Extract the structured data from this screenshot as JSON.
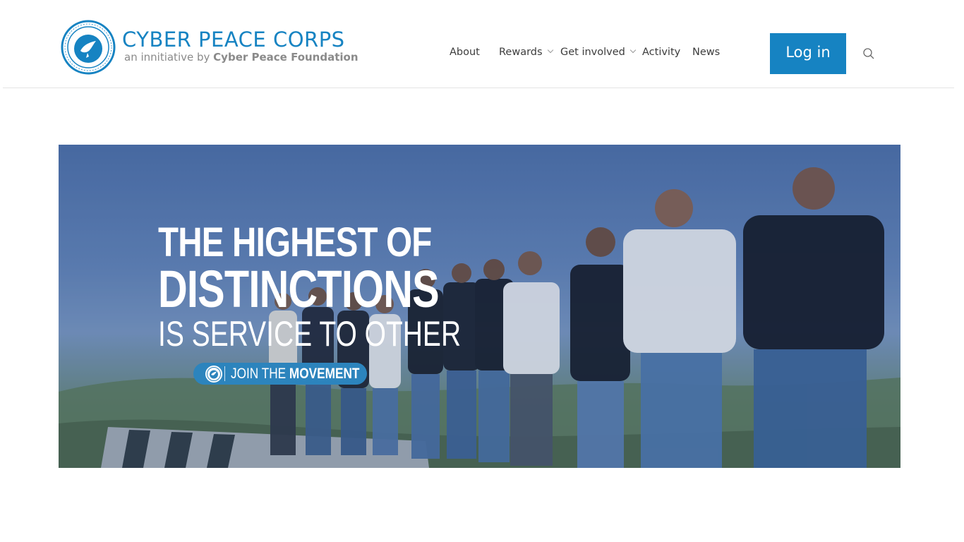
{
  "brand": {
    "title": "CYBER PEACE CORPS",
    "subtitle_prefix": "an innitiative by",
    "subtitle_org": "Cyber Peace Foundation",
    "emblem_text": "CYBER PEACE CORPS",
    "color": "#1683c2"
  },
  "nav": {
    "items": [
      {
        "label": "About",
        "dropdown": false
      },
      {
        "label": "Rewards",
        "dropdown": true
      },
      {
        "label": "Get involved",
        "dropdown": true
      },
      {
        "label": "Activity",
        "dropdown": false
      },
      {
        "label": "News",
        "dropdown": false
      }
    ]
  },
  "header": {
    "login_label": "Log in",
    "search_icon": "search-icon"
  },
  "hero": {
    "line1": "THE HIGHEST OF",
    "line2": "DISTINCTIONS",
    "line3": "IS SERVICE TO OTHER",
    "cta_light": "JOIN THE",
    "cta_bold": "MOVEMENT",
    "cta_color": "#2c84bd"
  }
}
